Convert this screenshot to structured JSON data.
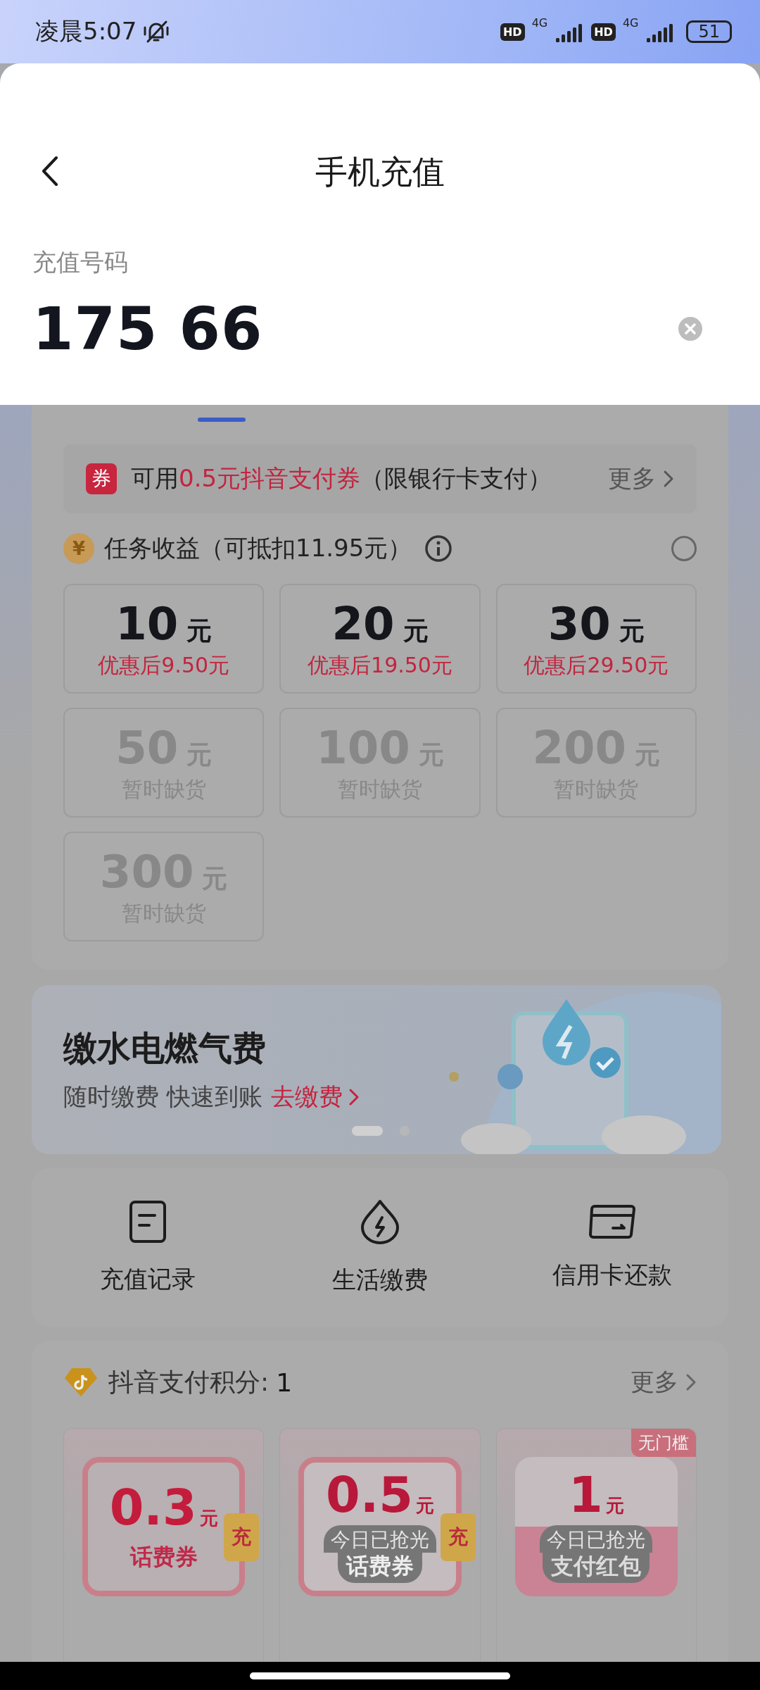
{
  "status_bar": {
    "time": "凌晨5:07",
    "sims": [
      {
        "badge": "HD",
        "network": "4G"
      },
      {
        "badge": "HD",
        "network": "4G"
      }
    ],
    "battery": "51"
  },
  "header": {
    "title": "手机充值"
  },
  "phone_field": {
    "label": "充值号码",
    "value": "175 66"
  },
  "tabs": [
    {
      "selected": true
    },
    {
      "selected": false
    }
  ],
  "coupon_bar": {
    "badge": "券",
    "prefix": "可用",
    "highlight": "0.5元抖音支付券",
    "suffix": "（限银行卡支付）",
    "more": "更多"
  },
  "task": {
    "coin": "¥",
    "text": "任务收益（可抵扣11.95元）",
    "checked": false
  },
  "amounts": [
    {
      "amount": "10",
      "unit": "元",
      "note": "优惠后9.50元",
      "available": true
    },
    {
      "amount": "20",
      "unit": "元",
      "note": "优惠后19.50元",
      "available": true
    },
    {
      "amount": "30",
      "unit": "元",
      "note": "优惠后29.50元",
      "available": true
    },
    {
      "amount": "50",
      "unit": "元",
      "note": "暂时缺货",
      "available": false
    },
    {
      "amount": "100",
      "unit": "元",
      "note": "暂时缺货",
      "available": false
    },
    {
      "amount": "200",
      "unit": "元",
      "note": "暂时缺货",
      "available": false
    },
    {
      "amount": "300",
      "unit": "元",
      "note": "暂时缺货",
      "available": false
    }
  ],
  "banner": {
    "title": "缴水电燃气费",
    "subtitle": "随时缴费 快速到账",
    "link": "去缴费",
    "dots": [
      {
        "selected": true
      },
      {
        "selected": false
      }
    ]
  },
  "quick_links": [
    {
      "kind": "record",
      "label": "充值记录"
    },
    {
      "kind": "bolt",
      "label": "生活缴费"
    },
    {
      "kind": "card",
      "label": "信用卡还款"
    }
  ],
  "points": {
    "label": "抖音支付积分:",
    "value": "1",
    "more": "更多"
  },
  "vouchers": [
    {
      "kind": "phone",
      "amount": "0.3",
      "unit": "元",
      "name": "话费券",
      "tag": "充",
      "sold_out": false
    },
    {
      "kind": "phone",
      "amount": "0.5",
      "unit": "元",
      "name": "话费券",
      "tag": "充",
      "sold_out": true,
      "sold_out_text": "今日已抢光"
    },
    {
      "kind": "redpacket",
      "amount": "1",
      "unit": "元",
      "name": "支付红包",
      "badge": "无门槛",
      "sold_out": true,
      "sold_out_text": "今日已抢光"
    }
  ]
}
